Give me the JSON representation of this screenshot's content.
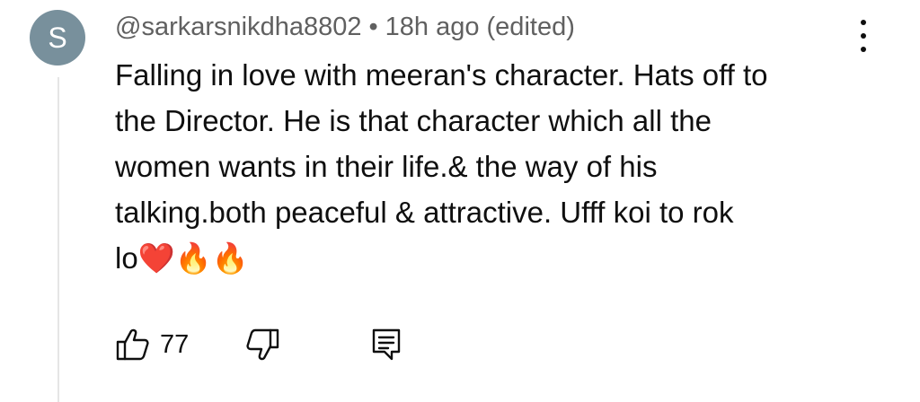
{
  "comment": {
    "avatar_letter": "S",
    "author": "@sarkarsnikdha8802",
    "separator": "•",
    "time": "18h ago (edited)",
    "text": "Falling in love with meeran's character. Hats off to\nthe Director. He is that character which all the\nwomen wants in their life.& the way of his\ntalking.both peaceful & attractive. Ufff koi to rok\nlo❤️🔥🔥",
    "like_count": "77"
  },
  "icons": {
    "more": "more-vert-icon",
    "like": "thumbs-up-icon",
    "dislike": "thumbs-down-icon",
    "reply": "reply-comment-icon"
  },
  "colors": {
    "avatar_bg": "#78909c",
    "meta_text": "#606060",
    "primary_text": "#0f0f0f"
  }
}
